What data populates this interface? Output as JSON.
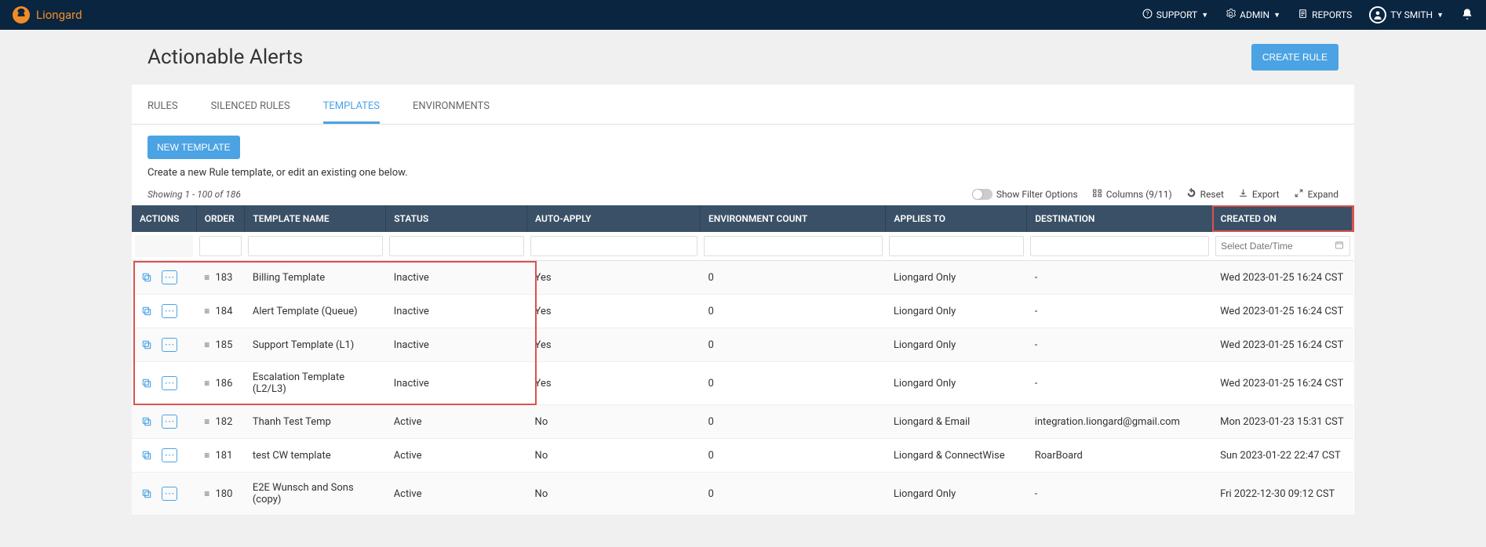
{
  "nav": {
    "brand": "Liongard",
    "support": "SUPPORT",
    "admin": "ADMIN",
    "reports": "REPORTS",
    "user": "TY SMITH"
  },
  "page": {
    "title": "Actionable Alerts",
    "create_rule": "CREATE RULE"
  },
  "tabs": {
    "rules": "RULES",
    "silenced": "SILENCED RULES",
    "templates": "TEMPLATES",
    "environments": "ENVIRONMENTS"
  },
  "tpl": {
    "new_btn": "NEW TEMPLATE",
    "hint": "Create a new Rule template, or edit an existing one below."
  },
  "toolbar": {
    "showing": "Showing 1 - 100 of 186",
    "filter_options": "Show Filter Options",
    "columns": "Columns (9/11)",
    "reset": "Reset",
    "export": "Export",
    "expand": "Expand"
  },
  "headers": {
    "actions": "ACTIONS",
    "order": "ORDER",
    "name": "TEMPLATE NAME",
    "status": "STATUS",
    "auto": "AUTO-APPLY",
    "env": "ENVIRONMENT COUNT",
    "applies": "APPLIES TO",
    "dest": "DESTINATION",
    "created": "CREATED ON"
  },
  "filters": {
    "date_placeholder": "Select Date/Time"
  },
  "rows": [
    {
      "order": "183",
      "name": "Billing Template",
      "status": "Inactive",
      "auto": "Yes",
      "env": "0",
      "applies": "Liongard Only",
      "dest": "-",
      "created": "Wed 2023-01-25 16:24 CST"
    },
    {
      "order": "184",
      "name": "Alert Template (Queue)",
      "status": "Inactive",
      "auto": "Yes",
      "env": "0",
      "applies": "Liongard Only",
      "dest": "-",
      "created": "Wed 2023-01-25 16:24 CST"
    },
    {
      "order": "185",
      "name": "Support Template (L1)",
      "status": "Inactive",
      "auto": "Yes",
      "env": "0",
      "applies": "Liongard Only",
      "dest": "-",
      "created": "Wed 2023-01-25 16:24 CST"
    },
    {
      "order": "186",
      "name": "Escalation Template (L2/L3)",
      "status": "Inactive",
      "auto": "Yes",
      "env": "0",
      "applies": "Liongard Only",
      "dest": "-",
      "created": "Wed 2023-01-25 16:24 CST"
    },
    {
      "order": "182",
      "name": "Thanh Test Temp",
      "status": "Active",
      "auto": "No",
      "env": "0",
      "applies": "Liongard & Email",
      "dest": "integration.liongard@gmail.com",
      "created": "Mon 2023-01-23 15:31 CST"
    },
    {
      "order": "181",
      "name": "test CW template",
      "status": "Active",
      "auto": "No",
      "env": "0",
      "applies": "Liongard & ConnectWise",
      "dest": "RoarBoard",
      "created": "Sun 2023-01-22 22:47 CST"
    },
    {
      "order": "180",
      "name": "E2E Wunsch and Sons (copy)",
      "status": "Active",
      "auto": "No",
      "env": "0",
      "applies": "Liongard Only",
      "dest": "-",
      "created": "Fri 2022-12-30 09:12 CST"
    }
  ]
}
